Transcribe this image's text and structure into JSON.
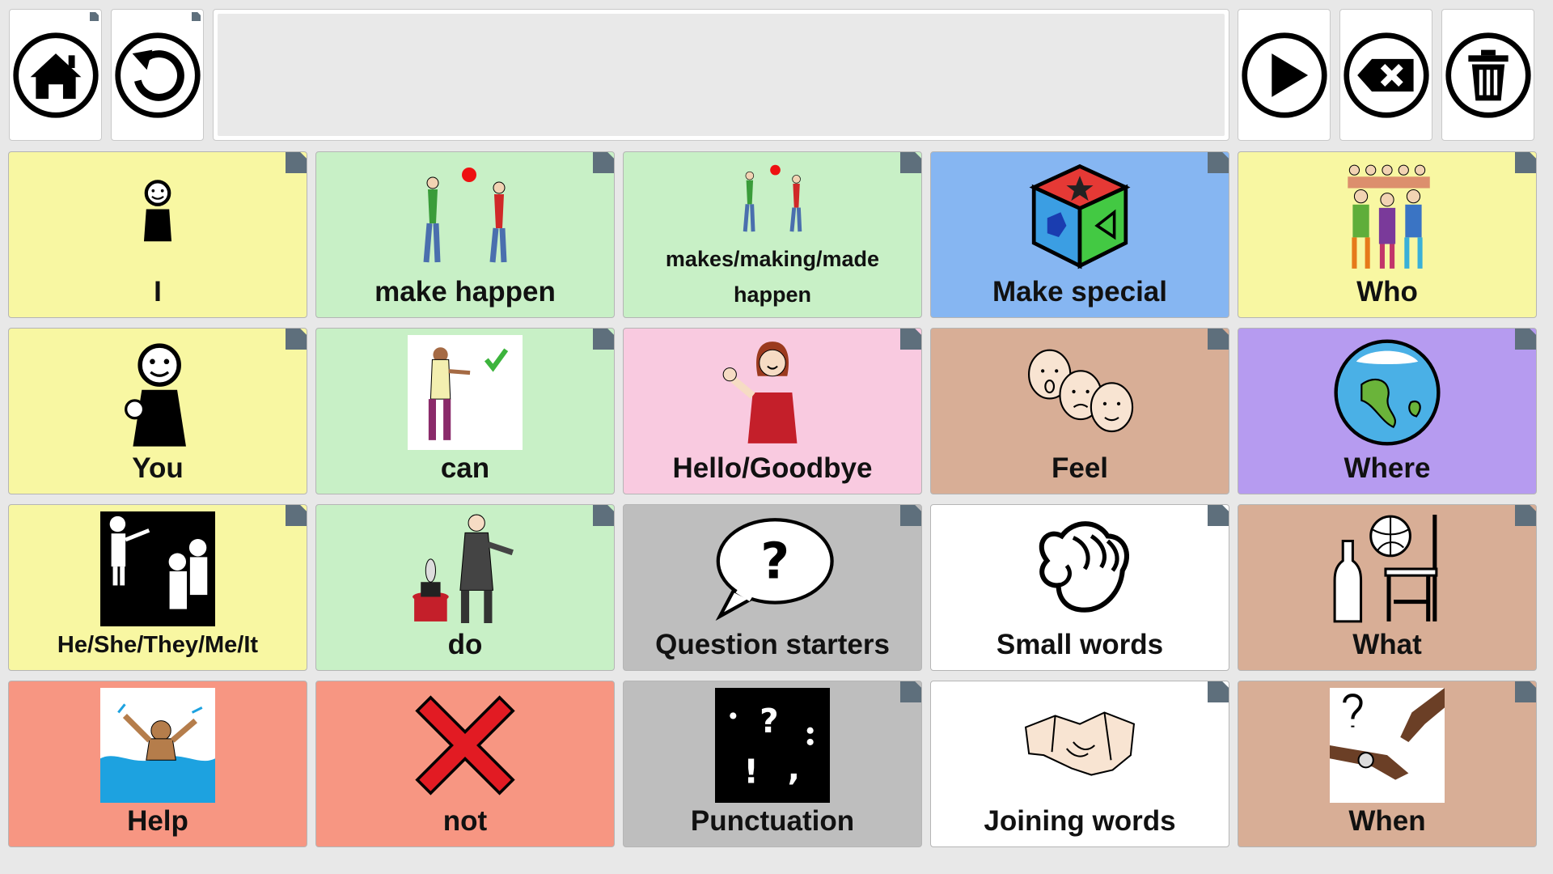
{
  "toolbar": {
    "home_icon": "home-icon",
    "undo_icon": "undo-icon",
    "message_text": "",
    "speak_icon": "play-icon",
    "backspace_icon": "backspace-icon",
    "clear_icon": "trash-icon"
  },
  "colors": {
    "yellow": "#f8f7a2",
    "green": "#c8f0c6",
    "blue": "#86b6f2",
    "pink": "#f9cae0",
    "tan": "#d8ae96",
    "purple": "#b69bf0",
    "grey": "#bebebe",
    "white": "#ffffff",
    "red": "#f79682",
    "folder_corner": "#5e6f7c"
  },
  "cells": [
    {
      "label": "I",
      "icon": "person-pointing-self-icon"
    },
    {
      "label": "make happen",
      "icon": "throwing-ball-icon"
    },
    {
      "label": "makes/making/made happen",
      "icon": "throwing-ball-icon"
    },
    {
      "label": "Make special",
      "icon": "shape-cube-icon"
    },
    {
      "label": "Who",
      "icon": "group-of-people-icon"
    },
    {
      "label": "You",
      "icon": "person-pointing-you-icon"
    },
    {
      "label": "can",
      "icon": "woman-thumbs-up-icon"
    },
    {
      "label": "Hello/Goodbye",
      "icon": "girl-waving-icon"
    },
    {
      "label": "Feel",
      "icon": "faces-emotions-icon"
    },
    {
      "label": "Where",
      "icon": "globe-icon"
    },
    {
      "label": "He/She/They/Me/It",
      "icon": "pronoun-people-icon"
    },
    {
      "label": "do",
      "icon": "magician-icon"
    },
    {
      "label": "Question starters",
      "icon": "question-bubble-icon"
    },
    {
      "label": "Small words",
      "icon": "pinch-hand-icon"
    },
    {
      "label": "What",
      "icon": "objects-bottle-ball-chair-icon"
    },
    {
      "label": "Help",
      "icon": "drowning-person-icon"
    },
    {
      "label": "not",
      "icon": "red-cross-icon"
    },
    {
      "label": "Punctuation",
      "icon": "punctuation-marks-icon"
    },
    {
      "label": "Joining words",
      "icon": "handshake-icon"
    },
    {
      "label": "When",
      "icon": "wristwatch-icon"
    }
  ]
}
